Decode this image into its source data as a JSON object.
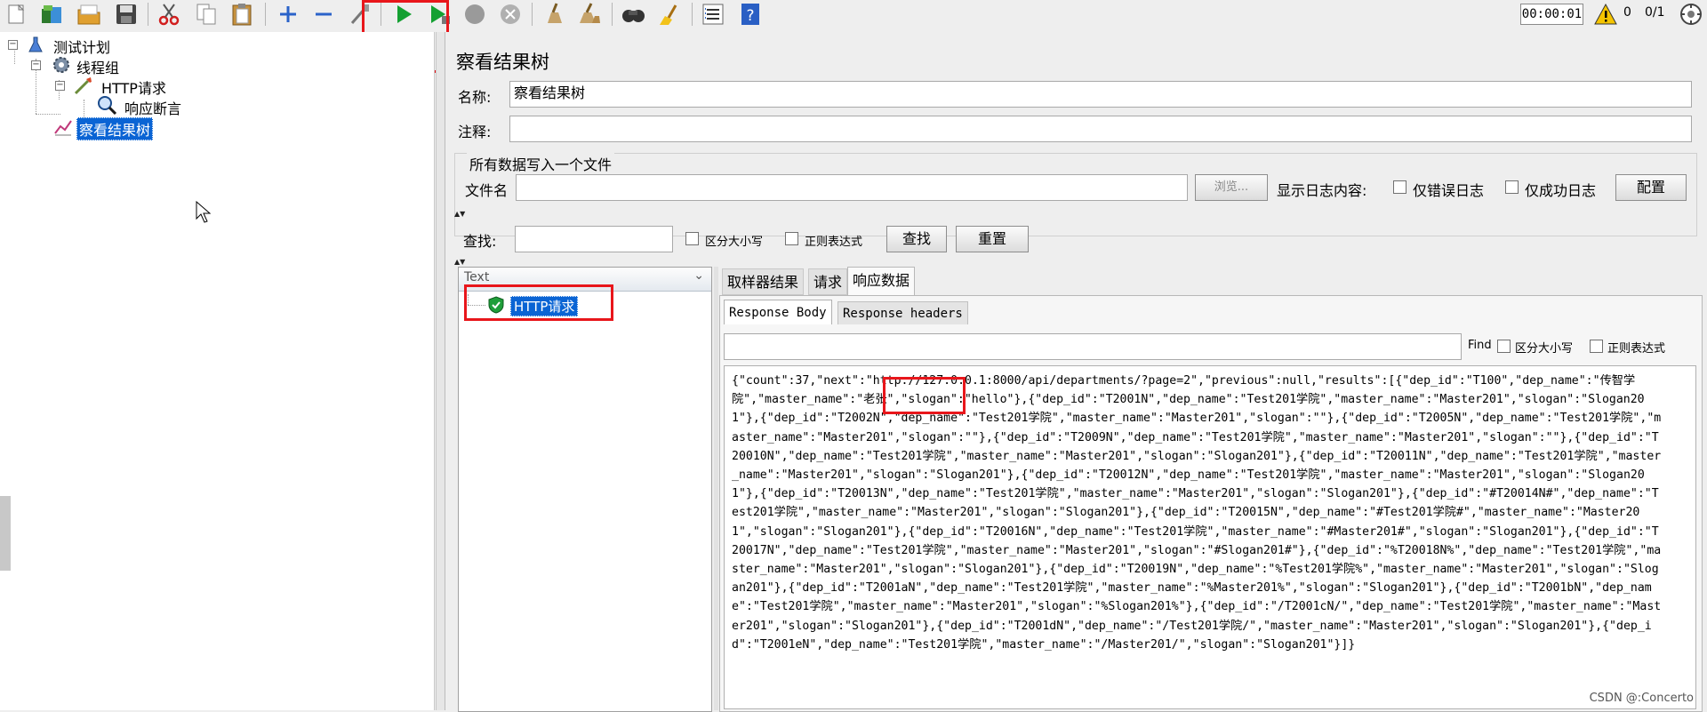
{
  "toolbar": {
    "timer": "00:00:01",
    "warning_count": "0",
    "thread_ratio": "0/1",
    "icons": [
      "new-icon",
      "templates-icon",
      "open-icon",
      "save-icon",
      "cut-icon",
      "copy-icon",
      "paste-icon",
      "expand-icon",
      "collapse-icon",
      "toggle-icon",
      "start-icon",
      "start-no-pause-icon",
      "stop-icon",
      "shutdown-icon",
      "clear-icon",
      "clear-all-icon",
      "search-icon",
      "reset-search-icon",
      "function-helper-icon",
      "help-icon",
      "warning-icon",
      "remote-icon"
    ]
  },
  "tree": {
    "items": [
      {
        "label": "测试计划",
        "icon": "test-plan-icon"
      },
      {
        "label": "线程组",
        "icon": "gear-icon"
      },
      {
        "label": "HTTP请求",
        "icon": "pipette-icon"
      },
      {
        "label": "响应断言",
        "icon": "magnifier-icon"
      },
      {
        "label": "察看结果树",
        "icon": "chart-icon",
        "selected": true
      }
    ]
  },
  "panel": {
    "title": "察看结果树",
    "name_label": "名称:",
    "name_value": "察看结果树",
    "comment_label": "注释:",
    "comment_value": "",
    "file_section_title": "所有数据写入一个文件",
    "file_label": "文件名",
    "file_value": "",
    "browse_label": "浏览...",
    "log_content_label": "显示日志内容:",
    "errors_only_label": "仅错误日志",
    "success_only_label": "仅成功日志",
    "configure_label": "配置",
    "search_label": "查找:",
    "search_value": "",
    "case_sensitive_label": "区分大小写",
    "regex_label": "正则表达式",
    "find_button": "查找",
    "reset_button": "重置"
  },
  "results": {
    "renderer_selected": "Text",
    "samples": [
      {
        "label": "HTTP请求",
        "status": "success"
      }
    ],
    "tabs": [
      "取样器结果",
      "请求",
      "响应数据"
    ],
    "active_tab": "响应数据",
    "subtabs": [
      "Response Body",
      "Response headers"
    ],
    "active_subtab": "Response Body",
    "find_label": "Find",
    "find_value": "",
    "find_case_label": "区分大小写",
    "find_regex_label": "正则表达式",
    "response_body": "{\"count\":37,\"next\":\"http://127.0.0.1:8000/api/departments/?page=2\",\"previous\":null,\"results\":[{\"dep_id\":\"T100\",\"dep_name\":\"传智学院\",\"master_name\":\"老张\",\"slogan\":\"hello\"},{\"dep_id\":\"T2001N\",\"dep_name\":\"Test201学院\",\"master_name\":\"Master201\",\"slogan\":\"Slogan201\"},{\"dep_id\":\"T2002N\",\"dep_name\":\"Test201学院\",\"master_name\":\"Master201\",\"slogan\":\"\"},{\"dep_id\":\"T2005N\",\"dep_name\":\"Test201学院\",\"master_name\":\"Master201\",\"slogan\":\"\"},{\"dep_id\":\"T2009N\",\"dep_name\":\"Test201学院\",\"master_name\":\"Master201\",\"slogan\":\"\"},{\"dep_id\":\"T20010N\",\"dep_name\":\"Test201学院\",\"master_name\":\"Master201\",\"slogan\":\"Slogan201\"},{\"dep_id\":\"T20011N\",\"dep_name\":\"Test201学院\",\"master_name\":\"Master201\",\"slogan\":\"Slogan201\"},{\"dep_id\":\"T20012N\",\"dep_name\":\"Test201学院\",\"master_name\":\"Master201\",\"slogan\":\"Slogan201\"},{\"dep_id\":\"T20013N\",\"dep_name\":\"Test201学院\",\"master_name\":\"Master201\",\"slogan\":\"Slogan201\"},{\"dep_id\":\"#T20014N#\",\"dep_name\":\"Test201学院\",\"master_name\":\"Master201\",\"slogan\":\"Slogan201\"},{\"dep_id\":\"T20015N\",\"dep_name\":\"#Test201学院#\",\"master_name\":\"Master201\",\"slogan\":\"Slogan201\"},{\"dep_id\":\"T20016N\",\"dep_name\":\"Test201学院\",\"master_name\":\"#Master201#\",\"slogan\":\"Slogan201\"},{\"dep_id\":\"T20017N\",\"dep_name\":\"Test201学院\",\"master_name\":\"Master201\",\"slogan\":\"#Slogan201#\"},{\"dep_id\":\"%T20018N%\",\"dep_name\":\"Test201学院\",\"master_name\":\"Master201\",\"slogan\":\"Slogan201\"},{\"dep_id\":\"T20019N\",\"dep_name\":\"%Test201学院%\",\"master_name\":\"Master201\",\"slogan\":\"Slogan201\"},{\"dep_id\":\"T2001aN\",\"dep_name\":\"Test201学院\",\"master_name\":\"%Master201%\",\"slogan\":\"Slogan201\"},{\"dep_id\":\"T2001bN\",\"dep_name\":\"Test201学院\",\"master_name\":\"Master201\",\"slogan\":\"%Slogan201%\"},{\"dep_id\":\"/T2001cN/\",\"dep_name\":\"Test201学院\",\"master_name\":\"Master201\",\"slogan\":\"Slogan201\"},{\"dep_id\":\"T2001dN\",\"dep_name\":\"/Test201学院/\",\"master_name\":\"Master201\",\"slogan\":\"Slogan201\"},{\"dep_id\":\"T2001eN\",\"dep_name\":\"Test201学院\",\"master_name\":\"/Master201/\",\"slogan\":\"Slogan201\"}]}"
  },
  "watermark": "CSDN @:Concerto",
  "colors": {
    "selection": "#0a64d4",
    "highlight_box": "#e8161b",
    "run_green": "#14a032",
    "background": "#eeeeee"
  }
}
